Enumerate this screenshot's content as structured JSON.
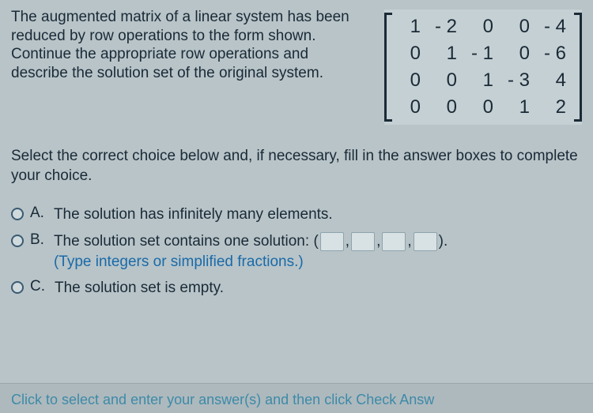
{
  "question": "The augmented matrix of a linear system has been reduced by row operations to the form shown. Continue the appropriate row operations and describe the solution set of the original system.",
  "matrix": {
    "rows": [
      [
        "1",
        "- 2",
        "0",
        "0",
        "- 4"
      ],
      [
        "0",
        "1",
        "- 1",
        "0",
        "- 6"
      ],
      [
        "0",
        "0",
        "1",
        "- 3",
        "4"
      ],
      [
        "0",
        "0",
        "0",
        "1",
        "2"
      ]
    ]
  },
  "instruction": "Select the correct choice below and, if necessary, fill in the answer boxes to complete your choice.",
  "choices": {
    "a": {
      "letter": "A.",
      "text": "The solution has infinitely many elements."
    },
    "b": {
      "letter": "B.",
      "text": "The solution set contains one solution:",
      "hint": "(Type integers or simplified fractions.)"
    },
    "c": {
      "letter": "C.",
      "text": "The solution set is empty."
    }
  },
  "footer": "Click to select and enter your answer(s) and then click Check Answ"
}
